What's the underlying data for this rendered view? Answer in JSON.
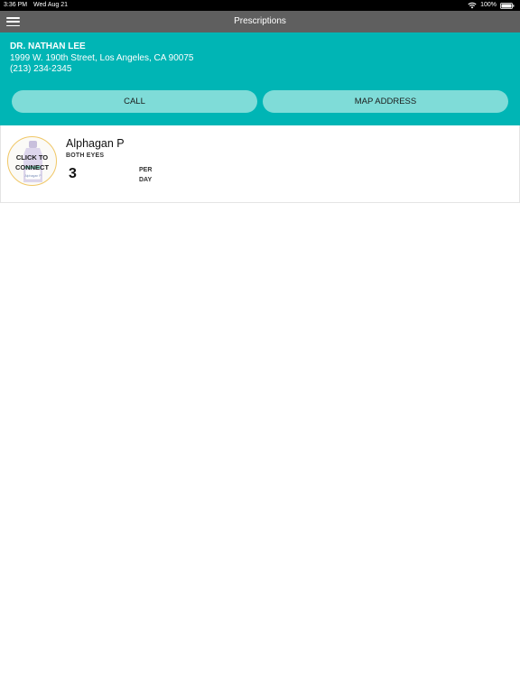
{
  "status_bar": {
    "time": "3:36 PM",
    "date": "Wed Aug 21",
    "battery": "100%"
  },
  "nav": {
    "title": "Prescriptions",
    "menu_icon": "hamburger-menu-icon"
  },
  "doctor": {
    "name": "DR. NATHAN LEE",
    "address": "1999 W. 190th Street, Los Angeles, CA 90075",
    "phone": "(213) 234-2345",
    "call_label": "CALL",
    "map_label": "MAP ADDRESS"
  },
  "prescriptions": [
    {
      "name": "Alphagan P",
      "eyes": "BOTH EYES",
      "count": "3",
      "per_line1": "PER",
      "per_line2": "DAY",
      "connect_line1": "CLICK TO",
      "connect_line2": "CONNECT",
      "bottle_label": "Alphagan P"
    }
  ],
  "colors": {
    "status_bar": "#000000",
    "nav_bar": "#5f5f5f",
    "teal_panel": "#00b5b5",
    "pill_button": "#7fdcd8",
    "ring": "#f0c766"
  }
}
